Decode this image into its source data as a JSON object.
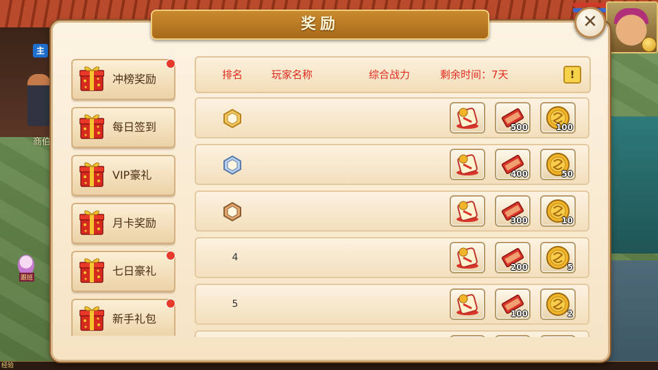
{
  "window": {
    "title": "奖励"
  },
  "scene": {
    "main_tag": "主",
    "npc_label": "商伯",
    "pet_label": "跟班",
    "exp_label": "经验"
  },
  "sidebar": {
    "items": [
      {
        "label": "冲榜奖励",
        "has_dot": true
      },
      {
        "label": "每日签到",
        "has_dot": false
      },
      {
        "label": "VIP豪礼",
        "has_dot": false
      },
      {
        "label": "月卡奖励",
        "has_dot": false
      },
      {
        "label": "七日豪礼",
        "has_dot": true
      },
      {
        "label": "新手礼包",
        "has_dot": true
      }
    ]
  },
  "header": {
    "rank": "排名",
    "player_name": "玩家名称",
    "power": "综合战力",
    "time_left": "剩余时间：7天",
    "info_icon": "!"
  },
  "ranks": [
    {
      "rank": "1",
      "medal": "gold",
      "rewards": [
        "",
        "500",
        "100"
      ]
    },
    {
      "rank": "2",
      "medal": "silver",
      "rewards": [
        "",
        "400",
        "50"
      ]
    },
    {
      "rank": "3",
      "medal": "bronze",
      "rewards": [
        "",
        "300",
        "10"
      ]
    },
    {
      "rank": "4",
      "medal": "",
      "rewards": [
        "",
        "200",
        "5"
      ]
    },
    {
      "rank": "5",
      "medal": "",
      "rewards": [
        "",
        "100",
        "2"
      ]
    },
    {
      "rank": "",
      "medal": "",
      "rewards": [
        "",
        "",
        ""
      ]
    }
  ],
  "reward_icons": [
    "scroll-token-icon",
    "red-ticket-icon",
    "gold-coin-icon"
  ],
  "colors": {
    "header_text": "#e0281e",
    "title_banner": "#c98a2e",
    "red_dot": "#e63a2a"
  }
}
